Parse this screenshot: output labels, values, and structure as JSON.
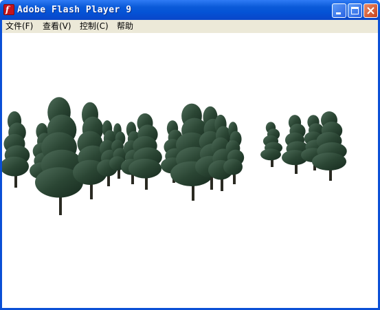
{
  "window": {
    "title": "Adobe Flash Player 9",
    "app_icon_glyph": "f",
    "icon_names": [
      "flash-player-icon",
      "minimize-icon",
      "maximize-icon",
      "close-icon"
    ],
    "titlebar_color": "#0a4fd6",
    "close_button_color": "#c6421d"
  },
  "menu": {
    "items": [
      {
        "label": "文件(F)"
      },
      {
        "label": "查看(V)"
      },
      {
        "label": "控制(C)"
      },
      {
        "label": "帮助"
      }
    ]
  },
  "stage": {
    "content": "flash-movie-trees",
    "background": "#ffffff",
    "tree_color": "#2e4a38"
  }
}
